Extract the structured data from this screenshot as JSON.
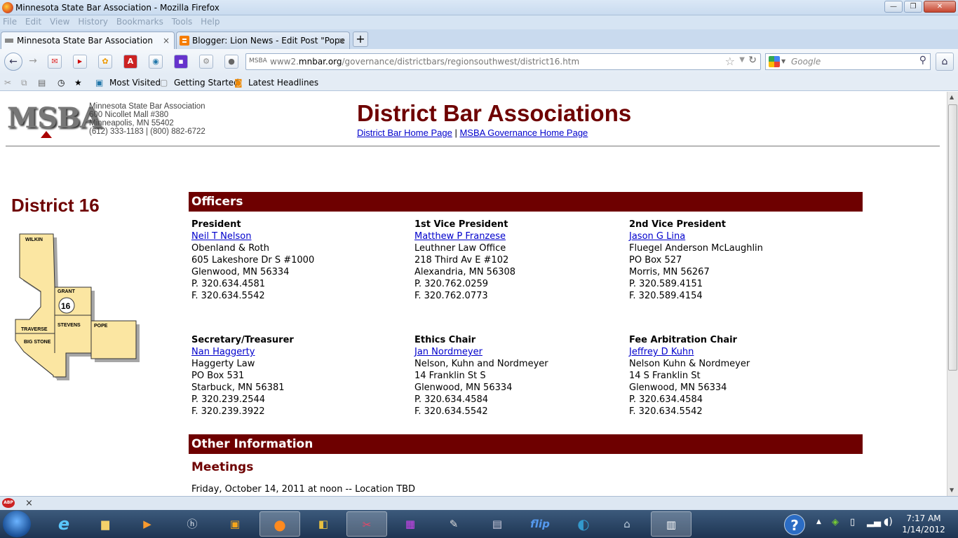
{
  "window": {
    "title": "Minnesota State Bar Association - Mozilla Firefox",
    "controls": {
      "minimize": "—",
      "maximize": "❐",
      "close": "✕"
    }
  },
  "menu": [
    "File",
    "Edit",
    "View",
    "History",
    "Bookmarks",
    "Tools",
    "Help"
  ],
  "tabs": [
    {
      "label": "Minnesota State Bar Association",
      "close": "×"
    },
    {
      "label": "Blogger: Lion News - Edit Post \"Pope ...",
      "close": "×"
    }
  ],
  "new_tab": "+",
  "nav": {
    "back": "←",
    "forward": "→",
    "url_host": "www2.mnbar.org",
    "url_prefix": "www2.",
    "url_domain": "mnbar.org",
    "url_path": "/governance/districtbars/regionsouthwest/district16.htm",
    "site_id": "MSBA",
    "search_placeholder": "Google",
    "home": "⌂"
  },
  "bookmarks": [
    {
      "label": "Most Visited"
    },
    {
      "label": "Getting Started"
    },
    {
      "label": "Latest Headlines"
    }
  ],
  "header": {
    "logo": "MSBA",
    "org_name": "Minnesota State Bar Association",
    "street": "600 Nicollet Mall #380",
    "city": "Minneapolis, MN 55402",
    "phone": "(612) 333-1183 | (800) 882-6722",
    "title": "District Bar Associations",
    "link_home": "District Bar Home Page",
    "separator": "|",
    "link_governance": "MSBA Governance Home Page"
  },
  "district": {
    "title": "District 16",
    "map": {
      "counties": [
        "WILKIN",
        "GRANT",
        "TRAVERSE",
        "STEVENS",
        "POPE",
        "BIG STONE"
      ],
      "number": "16"
    }
  },
  "officers_heading": "Officers",
  "officers": [
    {
      "role": "President",
      "name": "Neil T Nelson",
      "lines": [
        "Obenland & Roth",
        "605 Lakeshore Dr S #1000",
        "Glenwood, MN 56334",
        "P. 320.634.4581",
        "F. 320.634.5542"
      ]
    },
    {
      "role": "1st Vice President",
      "name": "Matthew P Franzese",
      "lines": [
        "Leuthner Law Office",
        "218 Third Av E #102",
        "Alexandria, MN 56308",
        "P. 320.762.0259",
        "F. 320.762.0773"
      ]
    },
    {
      "role": "2nd Vice President",
      "name": "Jason G Lina",
      "lines": [
        "Fluegel Anderson McLaughlin",
        "PO Box 527",
        "Morris, MN 56267",
        "P. 320.589.4151",
        "F. 320.589.4154"
      ]
    },
    {
      "role": "Secretary/Treasurer",
      "name": "Nan Haggerty",
      "lines": [
        "Haggerty Law",
        "PO Box 531",
        "Starbuck, MN 56381",
        "P. 320.239.2544",
        "F. 320.239.3922"
      ]
    },
    {
      "role": "Ethics Chair",
      "name": "Jan Nordmeyer",
      "lines": [
        "Nelson, Kuhn and Nordmeyer",
        "14 Franklin St S",
        "Glenwood, MN 56334",
        "P. 320.634.4584",
        "F. 320.634.5542"
      ]
    },
    {
      "role": "Fee Arbitration Chair",
      "name": "Jeffrey D Kuhn",
      "lines": [
        "Nelson Kuhn & Nordmeyer",
        "14 S Franklin St",
        "Glenwood, MN 56334",
        "P. 320.634.4584",
        "F. 320.634.5542"
      ]
    }
  ],
  "other_heading": "Other Information",
  "meetings": {
    "heading": "Meetings",
    "text": "Friday, October 14, 2011 at noon -- Location TBD"
  },
  "statusbar": {
    "abp": "ABP",
    "close": "×"
  },
  "taskbar": {
    "time": "7:17 AM",
    "date": "1/14/2012",
    "flip": "flip",
    "help": "?"
  },
  "colors": {
    "brand": "#6e0000",
    "link": "#0000cc"
  }
}
